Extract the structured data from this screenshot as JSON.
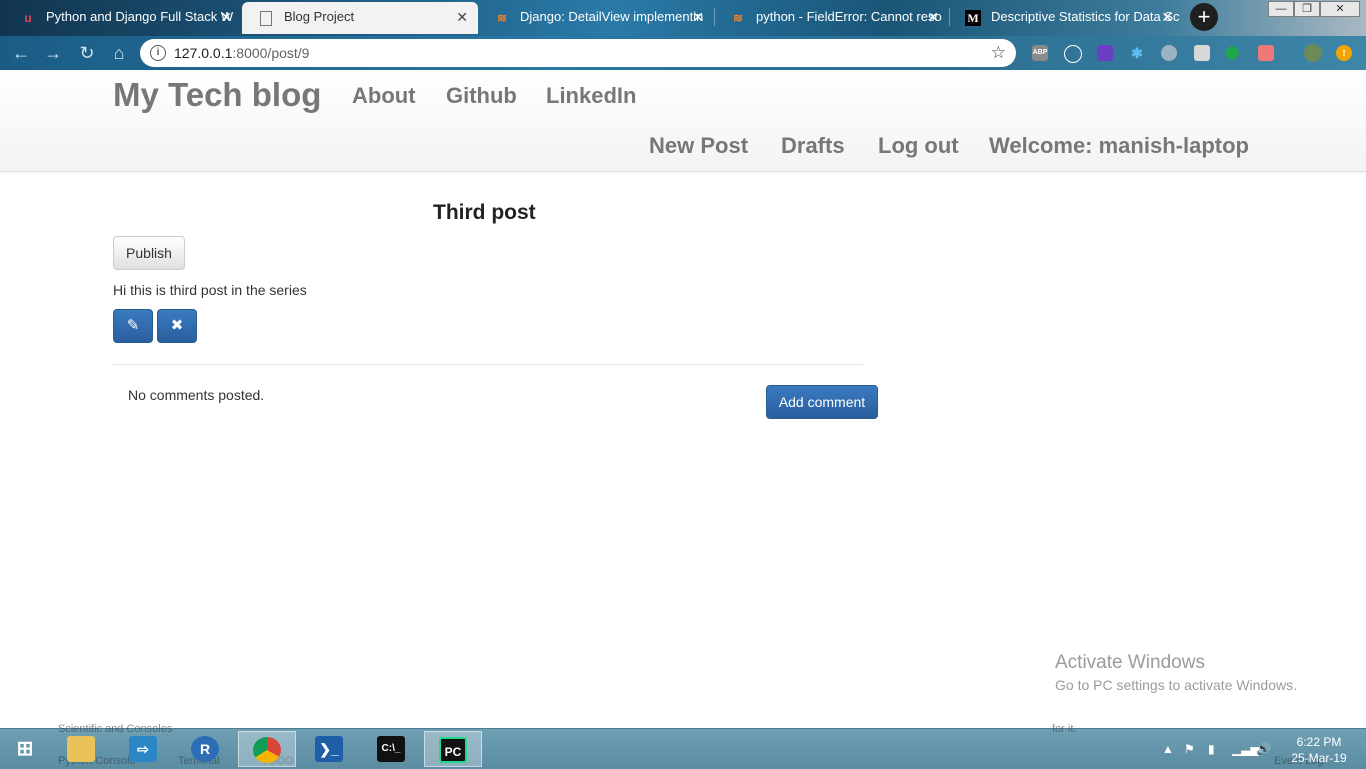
{
  "browser": {
    "tabs": [
      {
        "title": "Python and Django Full Stack W",
        "icon": "udemy-icon",
        "active": false
      },
      {
        "title": "Blog Project",
        "icon": "document-icon",
        "active": true
      },
      {
        "title": "Django: DetailView implementin",
        "icon": "stackoverflow-icon",
        "active": false
      },
      {
        "title": "python - FieldError: Cannot reso",
        "icon": "stackoverflow-icon",
        "active": false
      },
      {
        "title": "Descriptive Statistics for Data Sc",
        "icon": "medium-icon",
        "active": false
      }
    ],
    "url_host": "127.0.0.1",
    "url_path": ":8000/post/9",
    "extensions": [
      "ABP",
      "speed",
      "cube",
      "puzzle",
      "globe",
      "bulb",
      "green",
      "video",
      "avatar",
      "alert"
    ]
  },
  "site": {
    "brand": "My Tech blog",
    "nav_left": [
      "About",
      "Github",
      "LinkedIn"
    ],
    "nav_right": [
      "New Post",
      "Drafts",
      "Log out",
      "Welcome: manish-laptop"
    ]
  },
  "post": {
    "title": "Third post",
    "publish_label": "Publish",
    "text": "Hi this is third post in the series",
    "edit_icon": "pencil-icon",
    "delete_icon": "remove-icon",
    "no_comments": "No comments posted.",
    "add_comment_label": "Add comment"
  },
  "watermark": {
    "heading": "Activate Windows",
    "subtext": "Go to PC settings to activate Windows."
  },
  "taskbar": {
    "apps": [
      "file-explorer",
      "remote-desktop",
      "r-language",
      "chrome",
      "powershell",
      "command-prompt",
      "pycharm"
    ],
    "time": "6:22 PM",
    "date": "25-Mar-19",
    "ghost_texts": [
      "Scientific and Consoles",
      "Python Console",
      "Terminal",
      "TODO",
      "Event Log",
      "for it."
    ]
  }
}
